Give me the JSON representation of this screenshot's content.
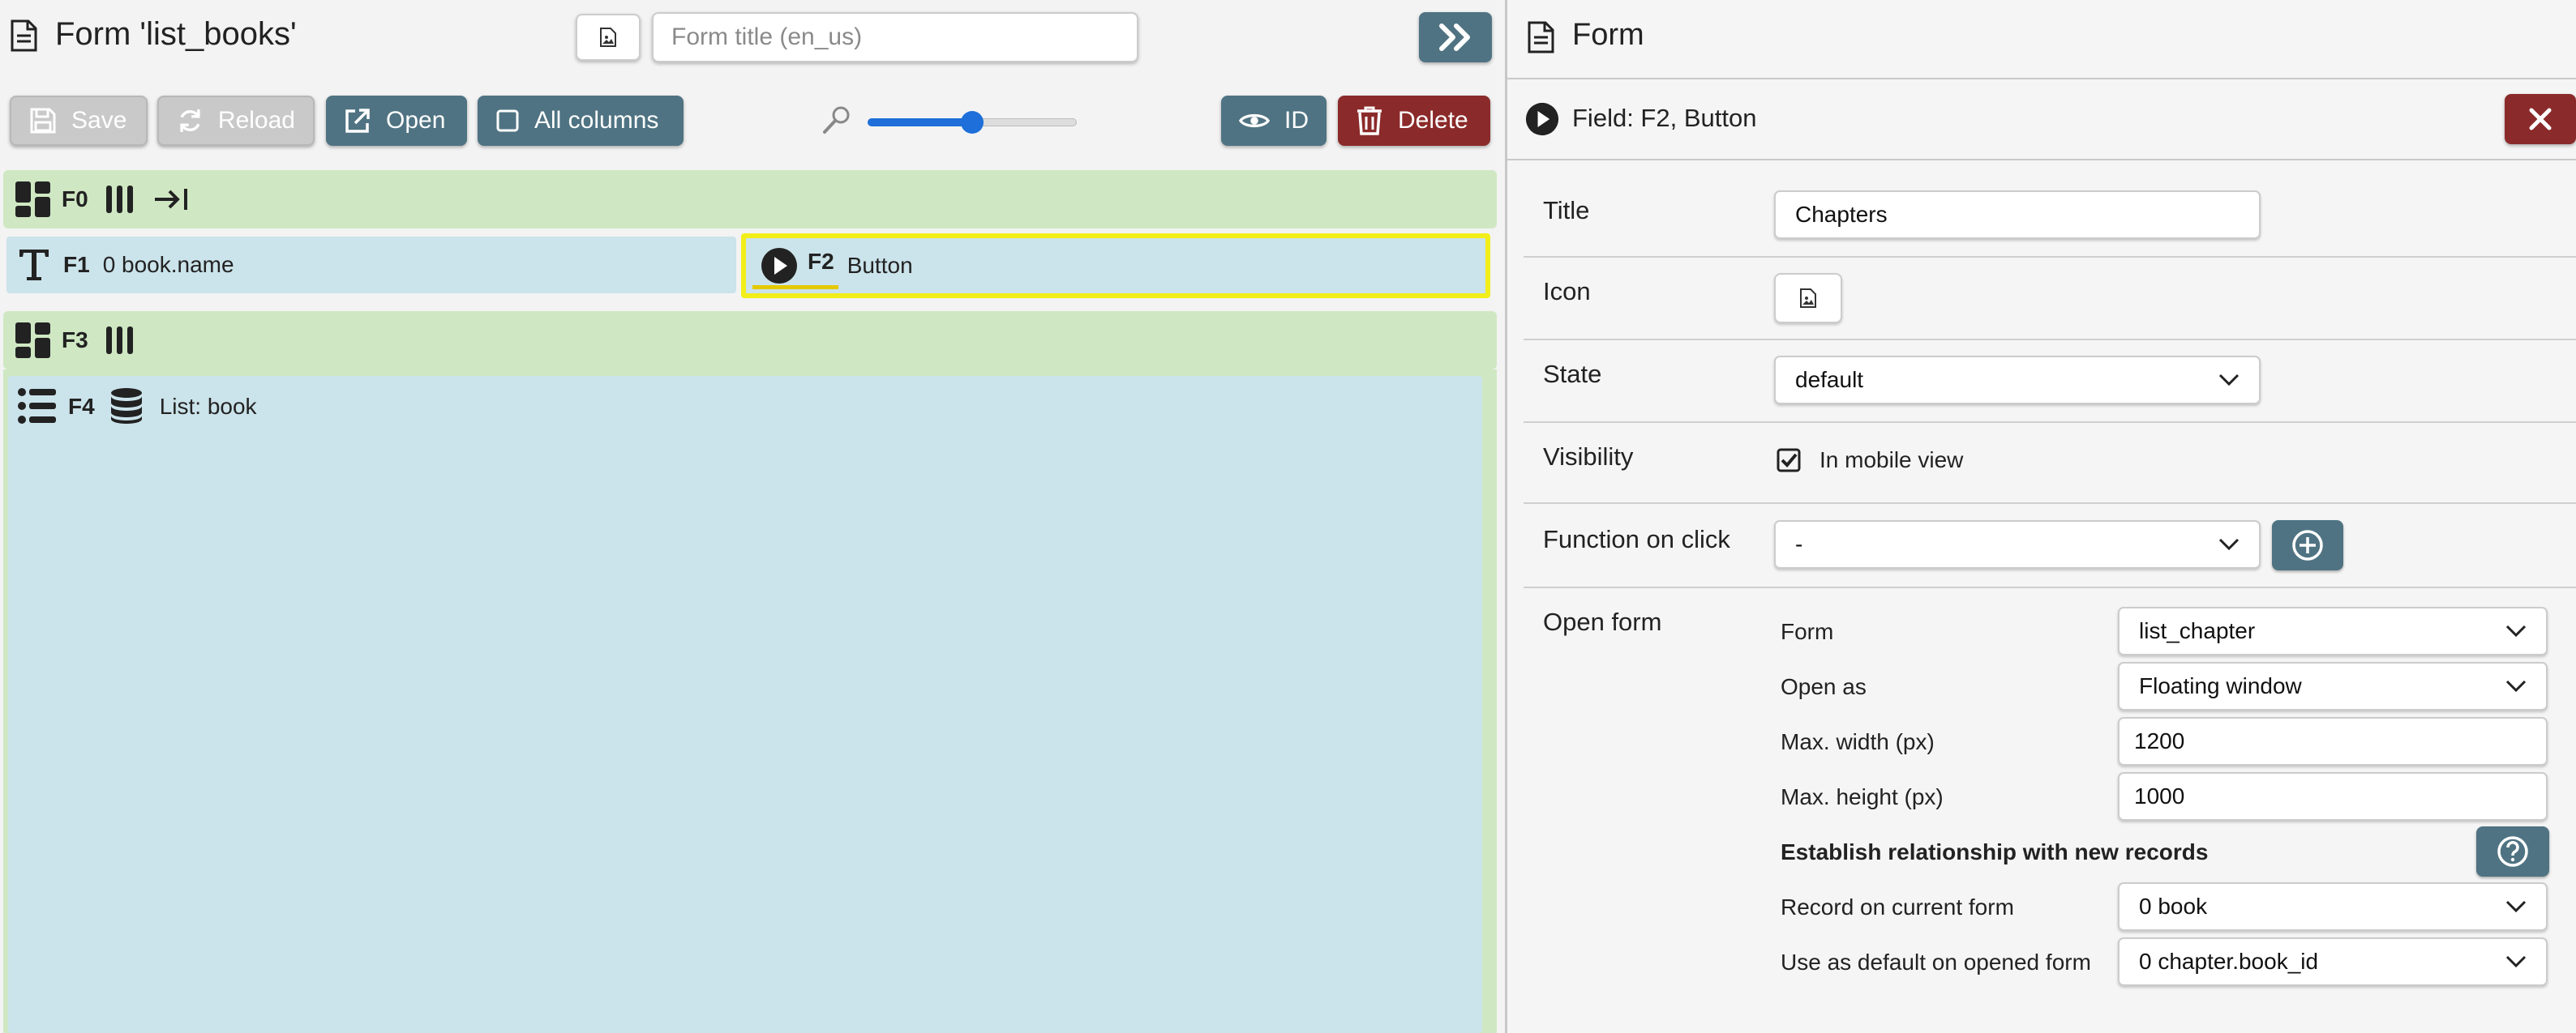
{
  "header": {
    "title": "Form 'list_books'",
    "title_placeholder": "Form title (en_us)",
    "icon_button": "image-icon",
    "expand_button": "double-chevron-right-icon"
  },
  "toolbar": {
    "save_label": "Save",
    "reload_label": "Reload",
    "open_label": "Open",
    "all_columns_label": "All columns",
    "id_label": "ID",
    "delete_label": "Delete",
    "zoom_level": 0.5
  },
  "grid": {
    "f0": {
      "id": "F0"
    },
    "f1": {
      "id": "F1",
      "label": "0 book.name"
    },
    "f2": {
      "id": "F2",
      "label": "Button"
    },
    "f3": {
      "id": "F3"
    },
    "f4": {
      "id": "F4",
      "label": "List: book"
    }
  },
  "panel": {
    "title": "Form",
    "field_header": "Field: F2, Button",
    "properties": {
      "title_label": "Title",
      "title_value": "Chapters",
      "icon_label": "Icon",
      "state_label": "State",
      "state_value": "default",
      "visibility_label": "Visibility",
      "visibility_option": "In mobile view",
      "visibility_checked": true,
      "function_label": "Function on click",
      "function_value": "-",
      "open_form_label": "Open form"
    },
    "open_form": {
      "form_label": "Form",
      "form_value": "list_chapter",
      "open_as_label": "Open as",
      "open_as_value": "Floating window",
      "max_width_label": "Max. width (px)",
      "max_width_value": "1200",
      "max_height_label": "Max. height (px)",
      "max_height_value": "1000",
      "relationship_heading": "Establish relationship with new records",
      "record_label": "Record on current form",
      "record_value": "0 book",
      "default_label": "Use as default on opened form",
      "default_value": "0 chapter.book_id"
    }
  },
  "colors": {
    "primary": "#4f7382",
    "danger": "#8b2a2a",
    "container": "#cfe8c3",
    "field": "#cbe3ea",
    "selection": "#f2ee19",
    "slider": "#1e6fd9"
  }
}
